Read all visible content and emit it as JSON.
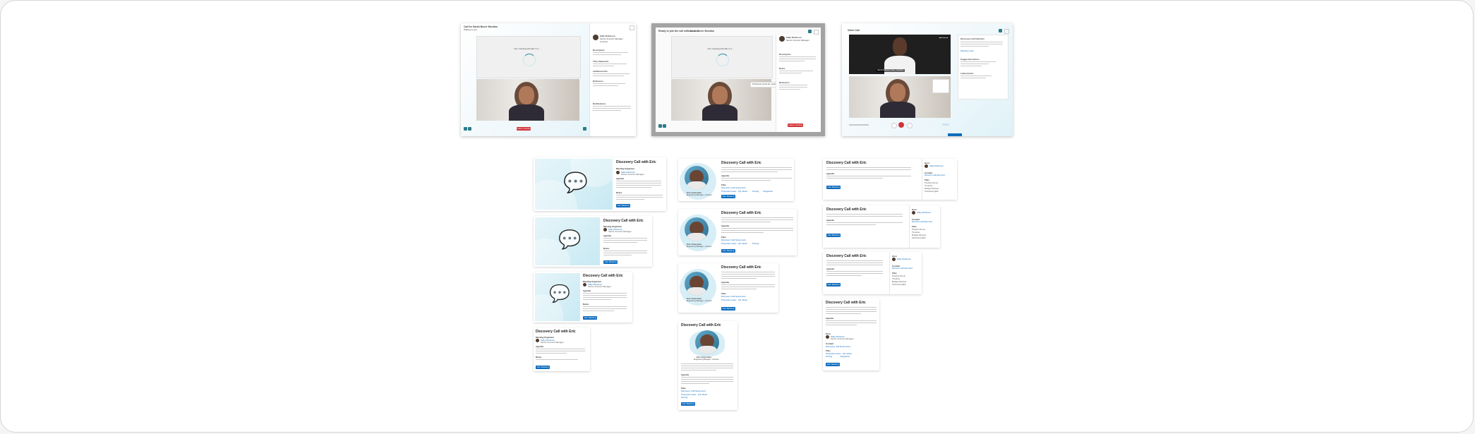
{
  "frames": {
    "frame1": {
      "title": "Call for Sarah Bucer Moulton",
      "subtitle": "Waiting to join",
      "loading_text": "Your meeting will start in a ...",
      "end_button": "Leave meeting",
      "contact_name": "Sally Robinson",
      "contact_role": "Senior Account Manager",
      "contact_detail": "Contoso",
      "sections": [
        "Description",
        "Time Statement",
        "Additional info",
        "Reference",
        "Notifications"
      ]
    },
    "frame2": {
      "title": "Ready to join the call with Sarah Bucer Moulton",
      "status": "Call ended",
      "loading_text": "Your meeting will start in a ...",
      "tooltip": "Participants joined the meeting",
      "end_button": "Leave meeting",
      "contact_name": "Sally Robinson",
      "contact_role": "Senior Account Manager",
      "sections": [
        "Description",
        "Notes",
        "Reference"
      ]
    },
    "frame3": {
      "title": "Video Call",
      "panel_title": "Discovery Call with Eric",
      "caption": "Jamie Peterson (You) • Contoso",
      "panel_link": "Meeting notes",
      "sections": [
        "Suggested actions",
        "Linked items"
      ]
    }
  },
  "cards": {
    "title": "Discovery Call with Eric",
    "host_label": "Host",
    "organizer_label": "Meeting Organizer",
    "organizer_name": "Sally Robinson",
    "organizer_role": "Senior Account Manager",
    "agenda_label": "Agenda",
    "notes_label": "Notes",
    "files_label": "Files",
    "contact_label": "Contact",
    "contact_link": "Discovery Call Notes.docx",
    "person_name": "Eric Ackerman",
    "person_role": "Engineering Manager • Contoso",
    "join_button": "Join Meeting",
    "description": "Let's discuss the proposal and review timelines for the project rollout.",
    "notes": "Eric asked to review pricing tiers and integration options before the call.",
    "chips": [
      "Proposal review",
      "Q3 rollout",
      "Pricing",
      "Integration"
    ],
    "tags": [
      "Product Demo",
      "Timeline",
      "Budget Review",
      "Technical Q&A"
    ]
  }
}
